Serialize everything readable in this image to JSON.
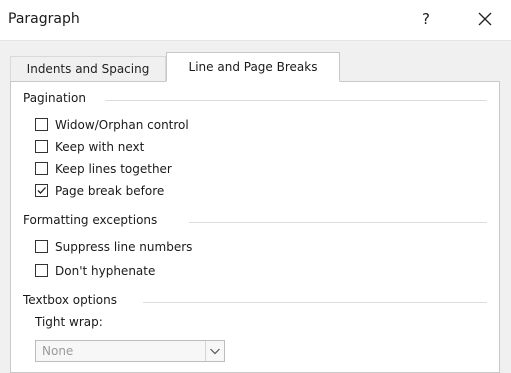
{
  "window": {
    "title": "Paragraph",
    "help_label": "?"
  },
  "tabs": [
    {
      "label": "Indents and Spacing",
      "active": false
    },
    {
      "label": "Line and Page Breaks",
      "active": true
    }
  ],
  "pagination": {
    "title": "Pagination",
    "options": [
      {
        "label": "Widow/Orphan control",
        "checked": false
      },
      {
        "label": "Keep with next",
        "checked": false
      },
      {
        "label": "Keep lines together",
        "checked": false
      },
      {
        "label": "Page break before",
        "checked": true
      }
    ]
  },
  "formatting_exceptions": {
    "title": "Formatting exceptions",
    "options": [
      {
        "label": "Suppress line numbers",
        "checked": false
      },
      {
        "label": "Don't hyphenate",
        "checked": false
      }
    ]
  },
  "textbox_options": {
    "title": "Textbox options",
    "tight_wrap_label": "Tight wrap:",
    "tight_wrap_value": "None"
  },
  "icons": {
    "close": "close-icon",
    "checkmark": "checkmark-icon",
    "dropdown": "chevron-down-icon"
  }
}
